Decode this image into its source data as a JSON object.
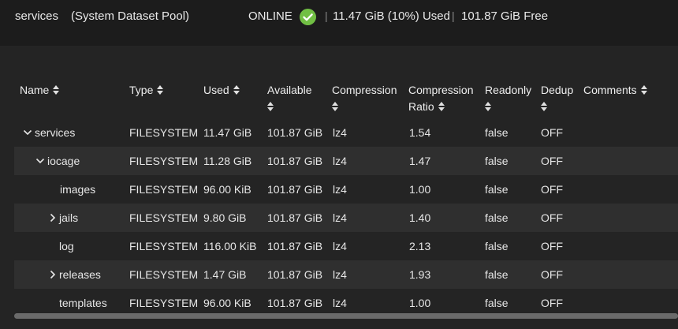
{
  "header": {
    "pool_name": "services",
    "pool_description": "(System Dataset Pool)",
    "status": "ONLINE",
    "status_icon": "check-circle-icon",
    "status_color": "#71bf44",
    "separator": "|",
    "used_summary": "11.47 GiB (10%) Used",
    "free_summary": "101.87 GiB Free"
  },
  "table": {
    "columns": {
      "name": "Name",
      "type": "Type",
      "used": "Used",
      "available": "Available",
      "compression": "Compression",
      "ratio_line1": "Compression",
      "ratio_line2": "Ratio",
      "readonly": "Readonly",
      "dedup": "Dedup",
      "comments": "Comments"
    },
    "rows": [
      {
        "name": "services",
        "type": "FILESYSTEM",
        "used": "11.47 GiB",
        "available": "101.87 GiB",
        "compression": "lz4",
        "ratio": "1.54",
        "readonly": "false",
        "dedup": "OFF",
        "comments": ""
      },
      {
        "name": "iocage",
        "type": "FILESYSTEM",
        "used": "11.28 GiB",
        "available": "101.87 GiB",
        "compression": "lz4",
        "ratio": "1.47",
        "readonly": "false",
        "dedup": "OFF",
        "comments": ""
      },
      {
        "name": "images",
        "type": "FILESYSTEM",
        "used": "96.00 KiB",
        "available": "101.87 GiB",
        "compression": "lz4",
        "ratio": "1.00",
        "readonly": "false",
        "dedup": "OFF",
        "comments": ""
      },
      {
        "name": "jails",
        "type": "FILESYSTEM",
        "used": "9.80 GiB",
        "available": "101.87 GiB",
        "compression": "lz4",
        "ratio": "1.40",
        "readonly": "false",
        "dedup": "OFF",
        "comments": ""
      },
      {
        "name": "log",
        "type": "FILESYSTEM",
        "used": "116.00 KiB",
        "available": "101.87 GiB",
        "compression": "lz4",
        "ratio": "2.13",
        "readonly": "false",
        "dedup": "OFF",
        "comments": ""
      },
      {
        "name": "releases",
        "type": "FILESYSTEM",
        "used": "1.47 GiB",
        "available": "101.87 GiB",
        "compression": "lz4",
        "ratio": "1.93",
        "readonly": "false",
        "dedup": "OFF",
        "comments": ""
      },
      {
        "name": "templates",
        "type": "FILESYSTEM",
        "used": "96.00 KiB",
        "available": "101.87 GiB",
        "compression": "lz4",
        "ratio": "1.00",
        "readonly": "false",
        "dedup": "OFF",
        "comments": ""
      }
    ]
  }
}
